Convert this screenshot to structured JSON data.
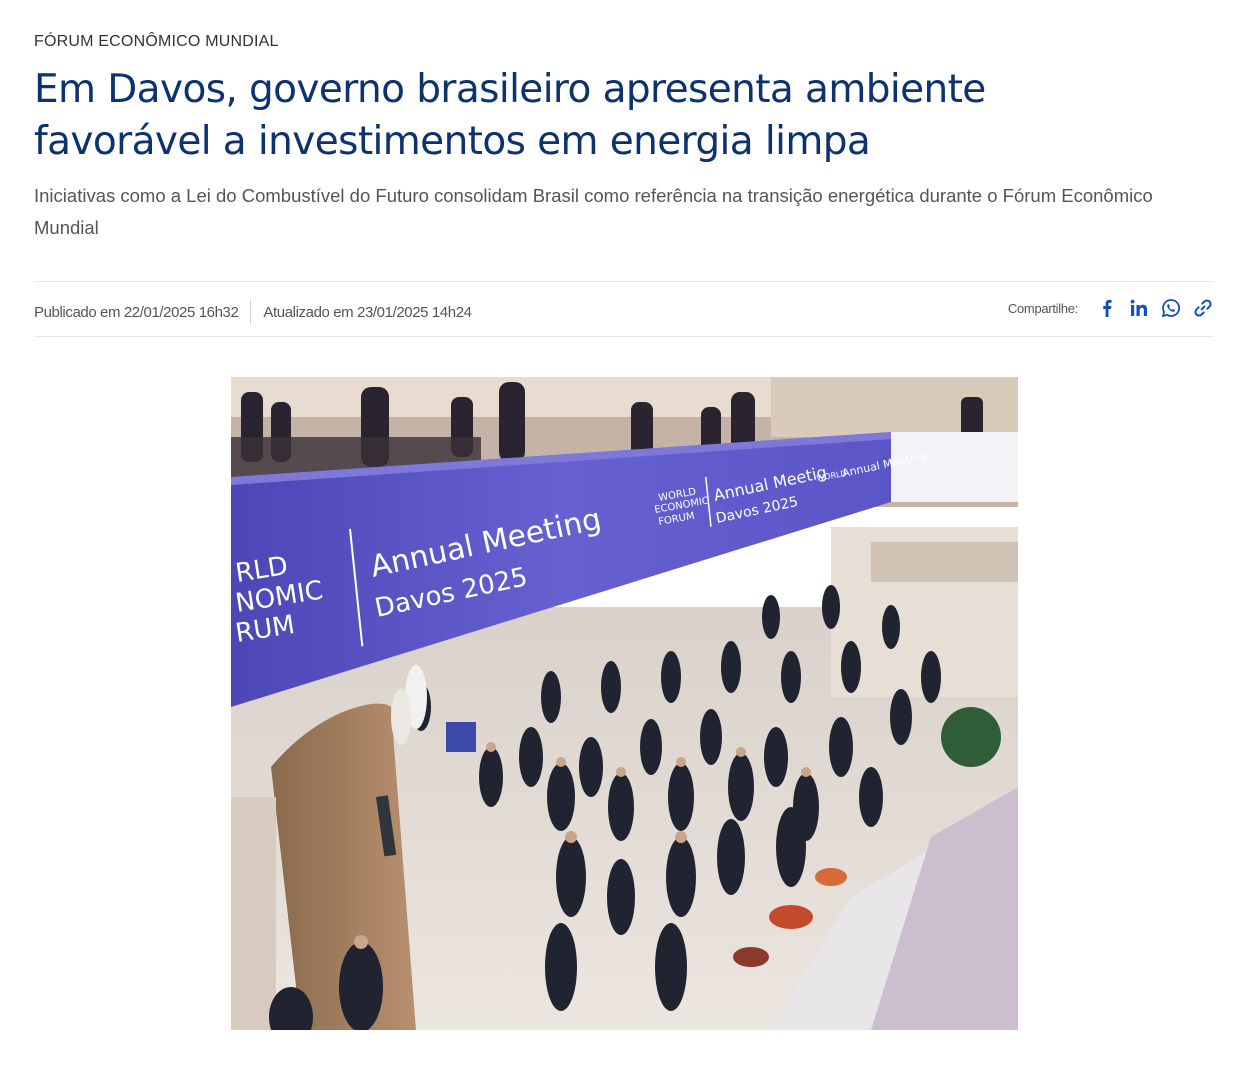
{
  "article": {
    "kicker": "FÓRUM ECONÔMICO MUNDIAL",
    "title": "Em Davos, governo brasileiro apresenta ambiente favorável a investimentos em energia limpa",
    "subtitle": "Iniciativas como a Lei do Combustível do Futuro consolidam Brasil como referência na transição energética durante o Fórum Econômico Mundial",
    "published": "Publicado em 22/01/2025 16h32",
    "updated": "Atualizado em 23/01/2025 14h24"
  },
  "share": {
    "label": "Compartilhe:",
    "icons": [
      "facebook-icon",
      "linkedin-icon",
      "whatsapp-icon",
      "link-icon"
    ],
    "accent": "#1351b4"
  },
  "image": {
    "banner_line1": "Annual Meeting",
    "banner_line2": "Davos 2025",
    "logo_lines": [
      "WORLD",
      "ECONOMIC",
      "FORUM"
    ],
    "colors": {
      "banner": "#5b55c8",
      "floor": "#e4ddd6",
      "ceiling": "#b8a79b"
    }
  }
}
